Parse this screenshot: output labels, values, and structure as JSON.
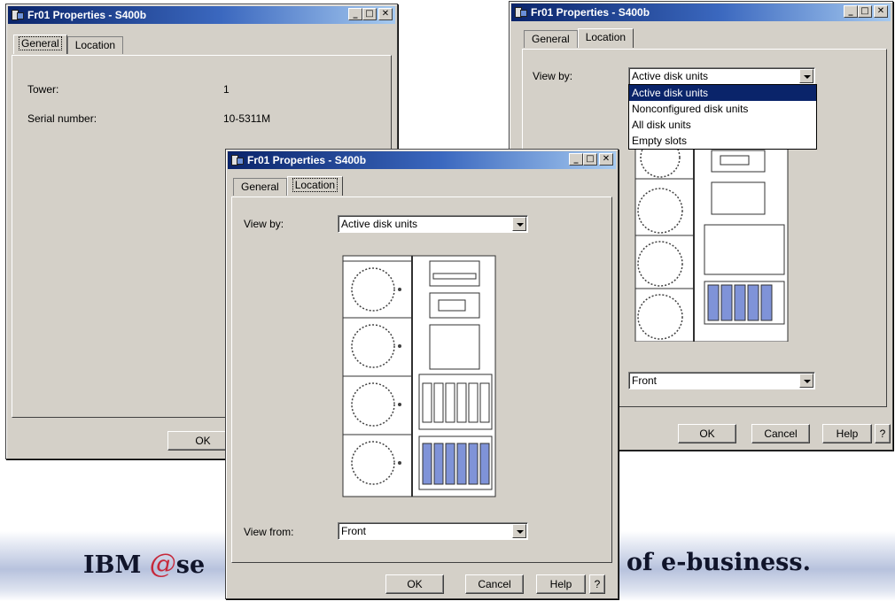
{
  "colors": {
    "titlebar_start": "#0a246a",
    "titlebar_end": "#a6caf0",
    "window_face": "#d4d0c8",
    "selection": "#0a246a",
    "disk_highlight": "#7f93d8",
    "brand_e": "#c6283a"
  },
  "banner": {
    "left_text": "IBM ",
    "e_glyph": "@",
    "left_tail": "se",
    "right_text": "of e-business."
  },
  "window_left": {
    "title": "Fr01 Properties - S400b",
    "controls": {
      "minimize": "_",
      "maximize": "□",
      "close": "✕"
    },
    "tabs": [
      {
        "label": "General"
      },
      {
        "label": "Location"
      }
    ],
    "active_tab": "General",
    "fields": {
      "tower_label": "Tower:",
      "tower_value": "1",
      "serial_label": "Serial number:",
      "serial_value": "10-5311M"
    },
    "ok_label": "OK"
  },
  "window_right": {
    "title": "Fr01 Properties - S400b",
    "controls": {
      "minimize": "_",
      "maximize": "□",
      "close": "✕"
    },
    "tabs": [
      {
        "label": "General"
      },
      {
        "label": "Location"
      }
    ],
    "active_tab": "Location",
    "view_by_label": "View by:",
    "view_by_value": "Active disk units",
    "view_by_options": [
      "Active disk units",
      "Nonconfigured disk units",
      "All disk units",
      "Empty slots"
    ],
    "view_from_value": "Front",
    "buttons": {
      "ok": "OK",
      "cancel": "Cancel",
      "help": "Help",
      "question": "?"
    }
  },
  "window_center": {
    "title": "Fr01 Properties - S400b",
    "controls": {
      "minimize": "_",
      "maximize": "□",
      "close": "✕"
    },
    "tabs": [
      {
        "label": "General"
      },
      {
        "label": "Location"
      }
    ],
    "active_tab": "Location",
    "view_by_label": "View by:",
    "view_by_value": "Active disk units",
    "view_from_label": "View from:",
    "view_from_value": "Front",
    "buttons": {
      "ok": "OK",
      "cancel": "Cancel",
      "help": "Help",
      "question": "?"
    }
  }
}
